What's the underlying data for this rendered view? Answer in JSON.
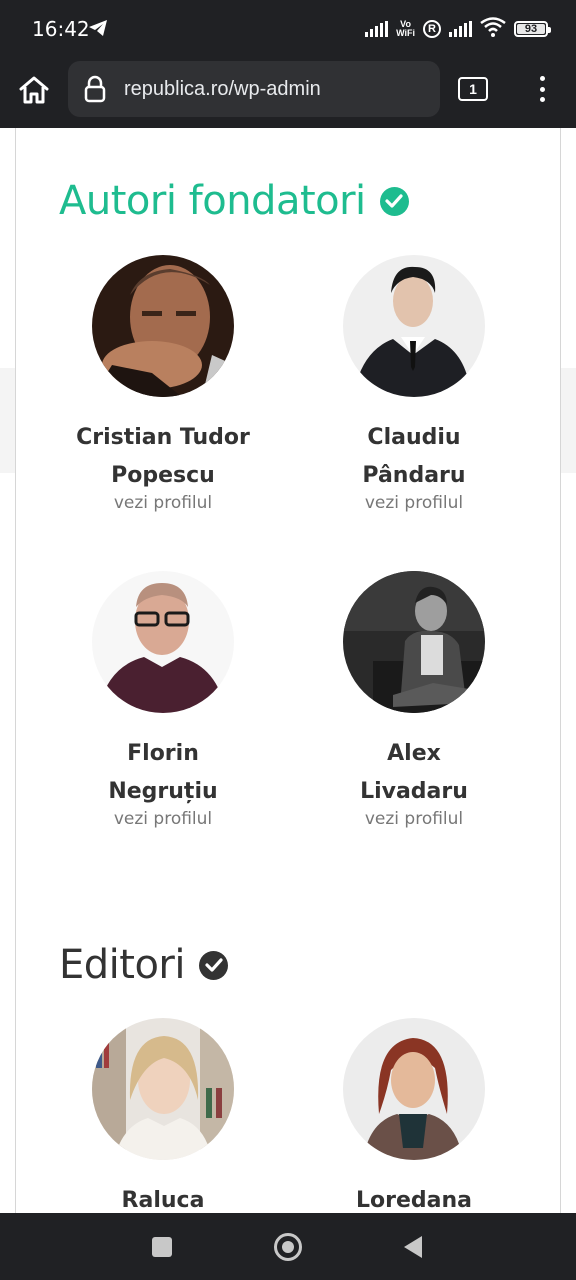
{
  "status": {
    "time": "16:42",
    "vowifi_line1": "Vo",
    "vowifi_line2": "WiFi",
    "roaming": "R",
    "battery": "93"
  },
  "browser": {
    "url": "republica.ro/wp-admin",
    "tab_count": "1"
  },
  "colors": {
    "accent_green": "#1ebc8f",
    "dark": "#333333",
    "muted": "#777777"
  },
  "sections": [
    {
      "title": "Autori fondatori",
      "check_color": "#1ebc8f",
      "people": [
        {
          "name_line1": "Cristian Tudor",
          "name_line2": "Popescu",
          "link": "vezi profilul"
        },
        {
          "name_line1": "Claudiu",
          "name_line2": "Pândaru",
          "link": "vezi profilul"
        },
        {
          "name_line1": "Florin",
          "name_line2": "Negruțiu",
          "link": "vezi profilul"
        },
        {
          "name_line1": "Alex",
          "name_line2": "Livadaru",
          "link": "vezi profilul"
        }
      ]
    },
    {
      "title": "Editori",
      "check_color": "#333333",
      "people": [
        {
          "name_line1": "Raluca",
          "name_line2": "",
          "link": ""
        },
        {
          "name_line1": "Loredana",
          "name_line2": "",
          "link": ""
        }
      ]
    }
  ]
}
